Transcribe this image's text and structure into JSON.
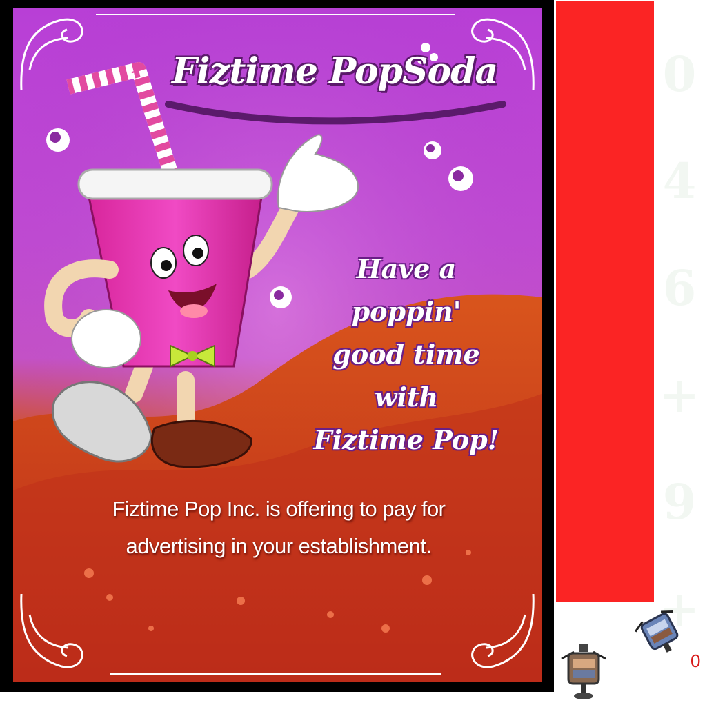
{
  "poster": {
    "brand_name": "Fiztime PopSoda",
    "slogan_lines": [
      "Have a",
      "poppin'",
      "good time",
      "with",
      "Fiztime Pop!"
    ],
    "offer_lines": [
      "Fiztime Pop Inc. is offering to pay for",
      "advertising in your establishment."
    ]
  },
  "side_panel": {
    "counter_value": "0",
    "ghost_glyphs": [
      "0",
      "4",
      "6",
      "+",
      "9",
      "+"
    ]
  },
  "colors": {
    "poster_purple": "#b83fd6",
    "poster_red": "#c8351c",
    "sidebar_red": "#fb2424",
    "counter_red": "#d91b1b"
  },
  "icons": [
    "ornate-corner-icon",
    "bubble-icon",
    "straw-icon",
    "soda-cup-mascot-icon",
    "spotlight-icon"
  ]
}
